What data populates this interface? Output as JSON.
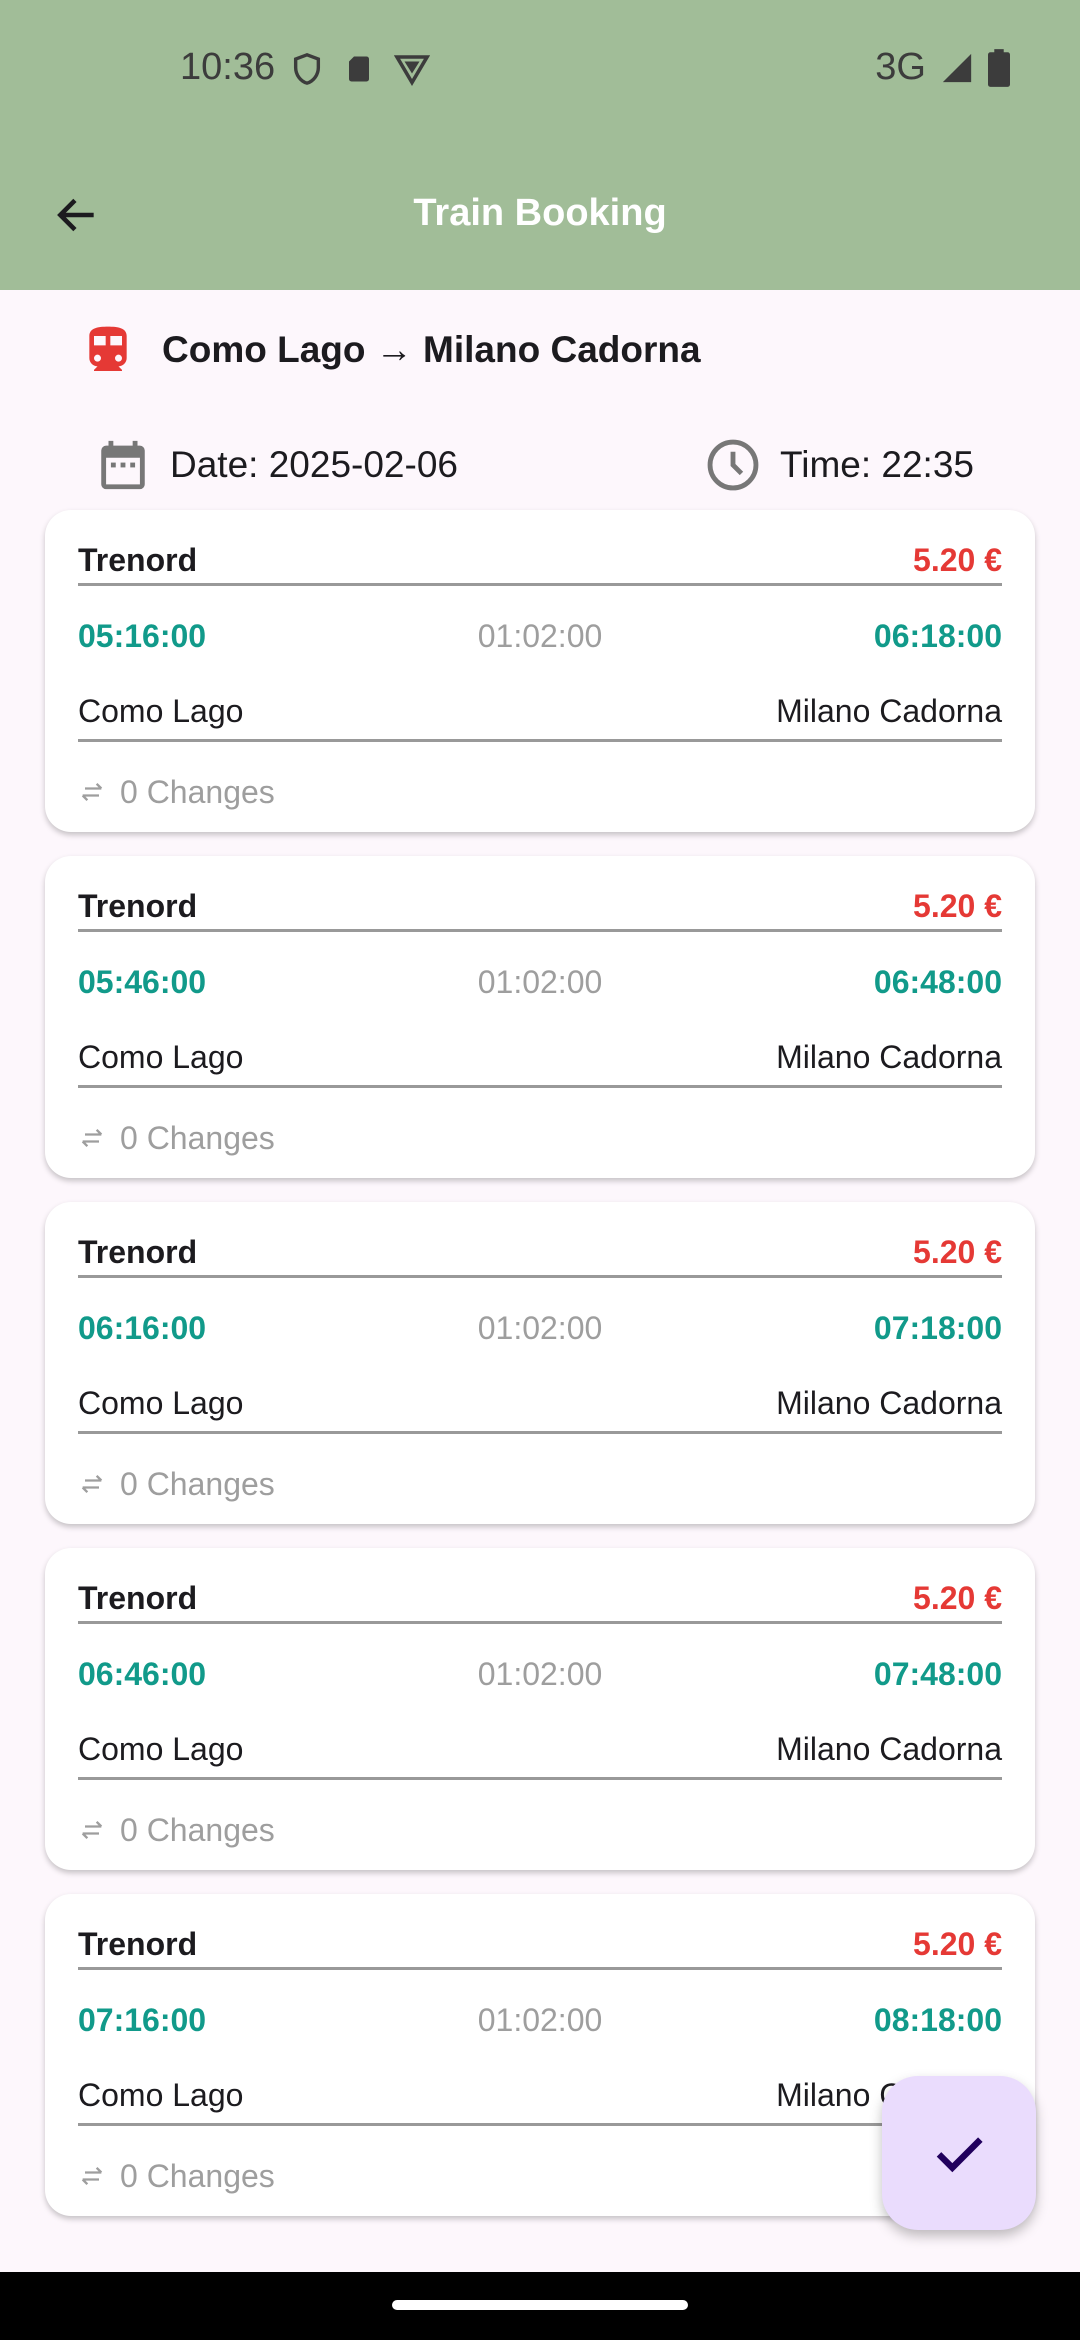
{
  "status_bar": {
    "time": "10:36",
    "network": "3G",
    "icons": [
      "shield-icon",
      "sd-card-icon",
      "vpn-icon",
      "signal-icon",
      "battery-icon"
    ]
  },
  "app_bar": {
    "title": "Train Booking"
  },
  "route": {
    "from": "Como Lago",
    "arrow": "→",
    "to": "Milano Cadorna"
  },
  "date_label": "Date: 2025-02-06",
  "time_label": "Time: 22:35",
  "connections": [
    {
      "operator": "Trenord",
      "price": "5.20 €",
      "departure": "05:16:00",
      "duration": "01:02:00",
      "arrival": "06:18:00",
      "from": "Como Lago",
      "to": "Milano Cadorna",
      "changes": "0 Changes"
    },
    {
      "operator": "Trenord",
      "price": "5.20 €",
      "departure": "05:46:00",
      "duration": "01:02:00",
      "arrival": "06:48:00",
      "from": "Como Lago",
      "to": "Milano Cadorna",
      "changes": "0 Changes"
    },
    {
      "operator": "Trenord",
      "price": "5.20 €",
      "departure": "06:16:00",
      "duration": "01:02:00",
      "arrival": "07:18:00",
      "from": "Como Lago",
      "to": "Milano Cadorna",
      "changes": "0 Changes"
    },
    {
      "operator": "Trenord",
      "price": "5.20 €",
      "departure": "06:46:00",
      "duration": "01:02:00",
      "arrival": "07:48:00",
      "from": "Como Lago",
      "to": "Milano Cadorna",
      "changes": "0 Changes"
    },
    {
      "operator": "Trenord",
      "price": "5.20 €",
      "departure": "07:16:00",
      "duration": "01:02:00",
      "arrival": "08:18:00",
      "from": "Como Lago",
      "to": "Milano Cadorna",
      "changes": "0 Changes"
    }
  ],
  "colors": {
    "app_bar": "#a1bd98",
    "price": "#e53935",
    "time": "#119a8a",
    "fab": "#eadcfd",
    "train_icon": "#e53935"
  }
}
